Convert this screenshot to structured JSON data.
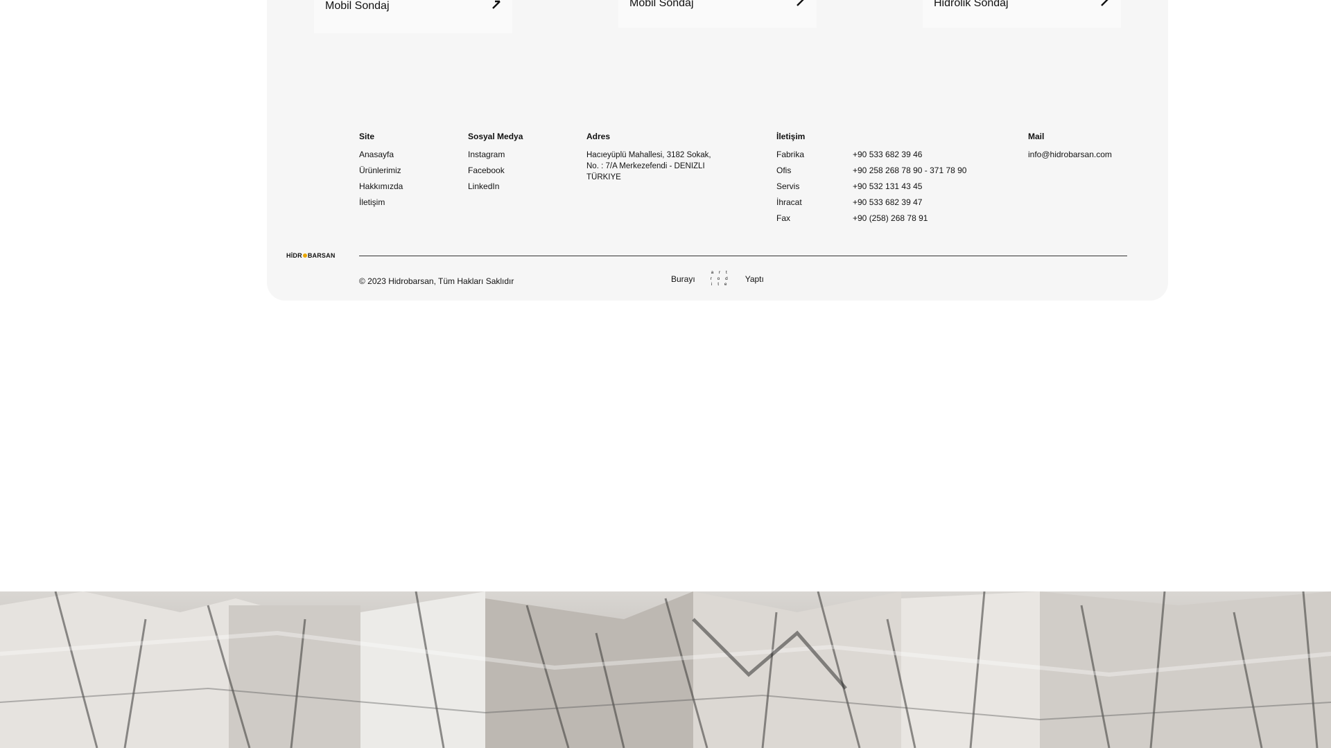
{
  "cards": [
    {
      "title": "Mobil Sondaj"
    },
    {
      "title": "Mobil Sondaj"
    },
    {
      "title": "Hidrolik Sondaj"
    }
  ],
  "footer": {
    "site": {
      "heading": "Site",
      "links": [
        "Anasayfa",
        "Ürünlerimiz",
        "Hakkımızda",
        "İletişim"
      ]
    },
    "social": {
      "heading": "Sosyal Medya",
      "links": [
        "Instagram",
        "Facebook",
        "LinkedIn"
      ]
    },
    "address": {
      "heading": "Adres",
      "lines": [
        "Hacıeyüplü Mahallesi, 3182 Sokak,",
        "No. : 7/A Merkezefendi - DENIZLI",
        "TÜRKIYE"
      ]
    },
    "contact": {
      "heading": "İletişim",
      "rows": [
        {
          "label": "Fabrika",
          "value": "+90 533 682 39 46"
        },
        {
          "label": "Ofis",
          "value": "+90 258 268 78 90 - 371 78 90"
        },
        {
          "label": "Servis",
          "value": "+90 532 131 43 45"
        },
        {
          "label": "İhracat",
          "value": "+90 533 682 39 47"
        },
        {
          "label": "Fax",
          "value": "+90 (258) 268 78 91"
        }
      ]
    },
    "mail": {
      "heading": "Mail",
      "address": "info@hidrobarsan.com"
    },
    "logo": {
      "left": "HİDR",
      "right": "BARSAN",
      "accent": "#e8a600"
    },
    "copyright": "© 2023 Hidrobarsan, Tüm Hakları Saklıdır",
    "made_by": {
      "prefix": "Burayı",
      "brand_lines": [
        "a r t",
        "r o d",
        "i t e"
      ],
      "suffix": "Yaptı"
    }
  },
  "colors": {
    "panel_bg": "#f6f6f6",
    "card_bg": "#fafafa",
    "page_bg": "#ffffff",
    "text": "#111111"
  },
  "icons": {
    "card_arrow": "chevron-right-icon"
  }
}
